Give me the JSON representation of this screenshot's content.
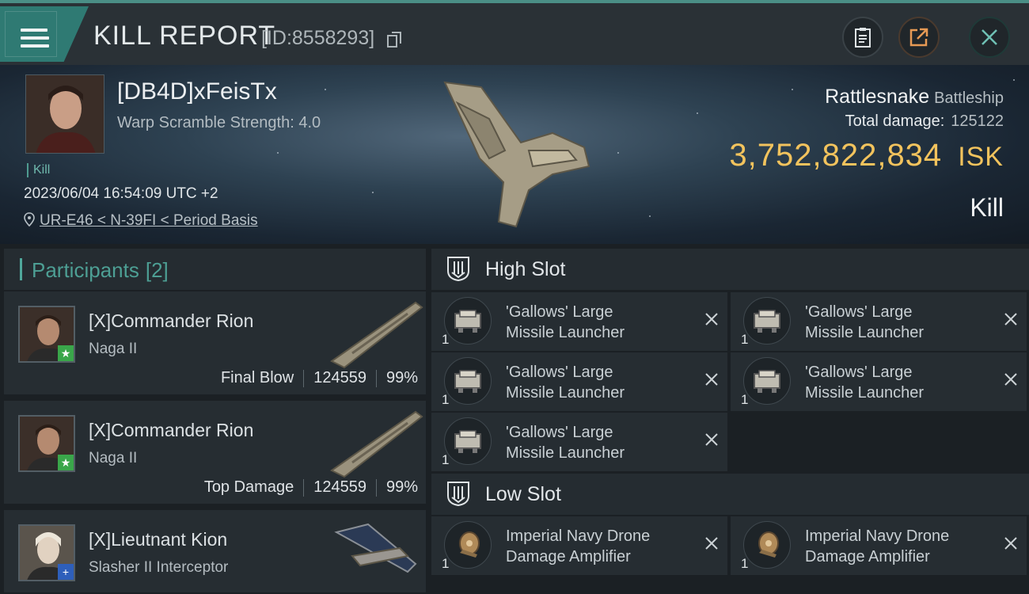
{
  "header": {
    "title": "KILL REPORT",
    "report_id": "[ID:8558293]",
    "icons": [
      "menu-icon",
      "copy-icon",
      "clipboard-icon",
      "share-icon",
      "close-icon"
    ]
  },
  "victim": {
    "name": "[DB4D]xFeisTx",
    "warp_scramble": "Warp Scramble Strength: 4.0",
    "tag": "Kill",
    "datetime": "2023/06/04 16:54:09 UTC +2",
    "location": "UR-E46 < N-39FI < Period Basis",
    "ship_name": "Rattlesnake",
    "ship_class": "Battleship",
    "total_damage_label": "Total damage:",
    "total_damage": "125122",
    "isk_value": "3,752,822,834",
    "isk_unit": "ISK",
    "outcome": "Kill"
  },
  "participants": {
    "label": "Participants",
    "count": "[2]",
    "list": [
      {
        "name": "[X]Commander Rion",
        "ship": "Naga II",
        "role": "Final Blow",
        "damage": "124559",
        "percent": "99%",
        "badge": "★"
      },
      {
        "name": "[X]Commander Rion",
        "ship": "Naga II",
        "role": "Top Damage",
        "damage": "124559",
        "percent": "99%",
        "badge": "★"
      },
      {
        "name": "[X]Lieutnant Kion",
        "ship": "Slasher II Interceptor",
        "badge": "+"
      }
    ]
  },
  "slots": {
    "high": {
      "label": "High Slot",
      "modules": [
        {
          "line1": "'Gallows' Large",
          "line2": "Missile Launcher",
          "qty": "1"
        },
        {
          "line1": "'Gallows' Large",
          "line2": "Missile Launcher",
          "qty": "1"
        },
        {
          "line1": "'Gallows' Large",
          "line2": "Missile Launcher",
          "qty": "1"
        },
        {
          "line1": "'Gallows' Large",
          "line2": "Missile Launcher",
          "qty": "1"
        },
        {
          "line1": "'Gallows' Large",
          "line2": "Missile Launcher",
          "qty": "1"
        }
      ]
    },
    "low": {
      "label": "Low Slot",
      "modules": [
        {
          "line1": "Imperial Navy Drone",
          "line2": "Damage Amplifier",
          "qty": "1"
        },
        {
          "line1": "Imperial Navy Drone",
          "line2": "Damage Amplifier",
          "qty": "1"
        }
      ]
    }
  },
  "colors": {
    "accent": "#4fa79b",
    "isk": "#f2c35d",
    "panel": "#262d32",
    "background": "#1b2024"
  }
}
